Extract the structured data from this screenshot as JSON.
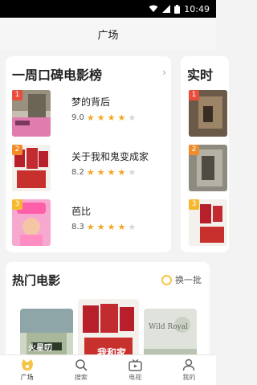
{
  "status_bar": {
    "time": "10:49"
  },
  "header": {
    "title": "广场"
  },
  "ranking_cards": [
    {
      "title": "一周口碑电影榜",
      "items": [
        {
          "rank": "1",
          "name": "梦的背后",
          "score": "9.0",
          "stars": 4
        },
        {
          "rank": "2",
          "name": "关于我和鬼变成家",
          "score": "8.2",
          "stars": 4
        },
        {
          "rank": "3",
          "name": "芭比",
          "score": "8.3",
          "stars": 4
        }
      ]
    },
    {
      "title": "实时",
      "items": [
        {
          "rank": "1"
        },
        {
          "rank": "2"
        },
        {
          "rank": "3"
        }
      ]
    }
  ],
  "hot_movies": {
    "title": "热门电影",
    "refresh_label": "换一批",
    "posters": [
      {
        "text": "火星叨"
      },
      {
        "text": "我和家"
      },
      {
        "text": "Wild Royal"
      }
    ]
  },
  "bottom_nav": [
    {
      "label": "广场",
      "icon": "plaza-icon",
      "active": true
    },
    {
      "label": "搜索",
      "icon": "search-icon"
    },
    {
      "label": "电视",
      "icon": "tv-icon"
    },
    {
      "label": "我的",
      "icon": "profile-icon"
    }
  ],
  "colors": {
    "rank1": "#e84d3d",
    "rank2": "#f08c2a",
    "rank3": "#f5b82e",
    "star": "#f4a623",
    "accent": "#f5c54b"
  }
}
